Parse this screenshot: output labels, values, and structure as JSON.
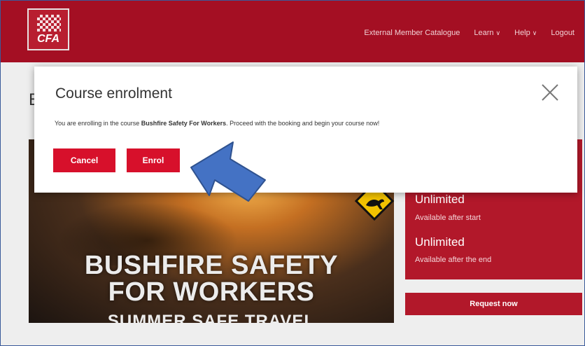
{
  "header": {
    "logo_text": "CFA",
    "nav": [
      {
        "label": "External Member Catalogue",
        "dropdown": false
      },
      {
        "label": "Learn",
        "dropdown": true
      },
      {
        "label": "Help",
        "dropdown": true
      },
      {
        "label": "Logout",
        "dropdown": false
      }
    ]
  },
  "page": {
    "title_fragment": "B",
    "hero": {
      "line1": "BUSHFIRE SAFETY",
      "line2": "FOR WORKERS",
      "line3": "SUMMER SAFE TRAVEL"
    },
    "side": {
      "value1": "Unlimited",
      "label1": "Available after start",
      "value2": "Unlimited",
      "label2": "Available after the end",
      "request_button": "Request now"
    }
  },
  "modal": {
    "title": "Course enrolment",
    "text_before": "You are enrolling in the course ",
    "course_name": "Bushfire Safety For Workers",
    "text_after": ". Proceed with the booking and begin your course now!",
    "cancel_label": "Cancel",
    "enrol_label": "Enrol"
  },
  "colors": {
    "brand": "#a40f23",
    "button": "#d7102b",
    "arrow": "#4472c4"
  },
  "icons": [
    "close-icon",
    "chevron-down-icon",
    "kangaroo-sign-icon",
    "pointer-arrow-icon"
  ]
}
